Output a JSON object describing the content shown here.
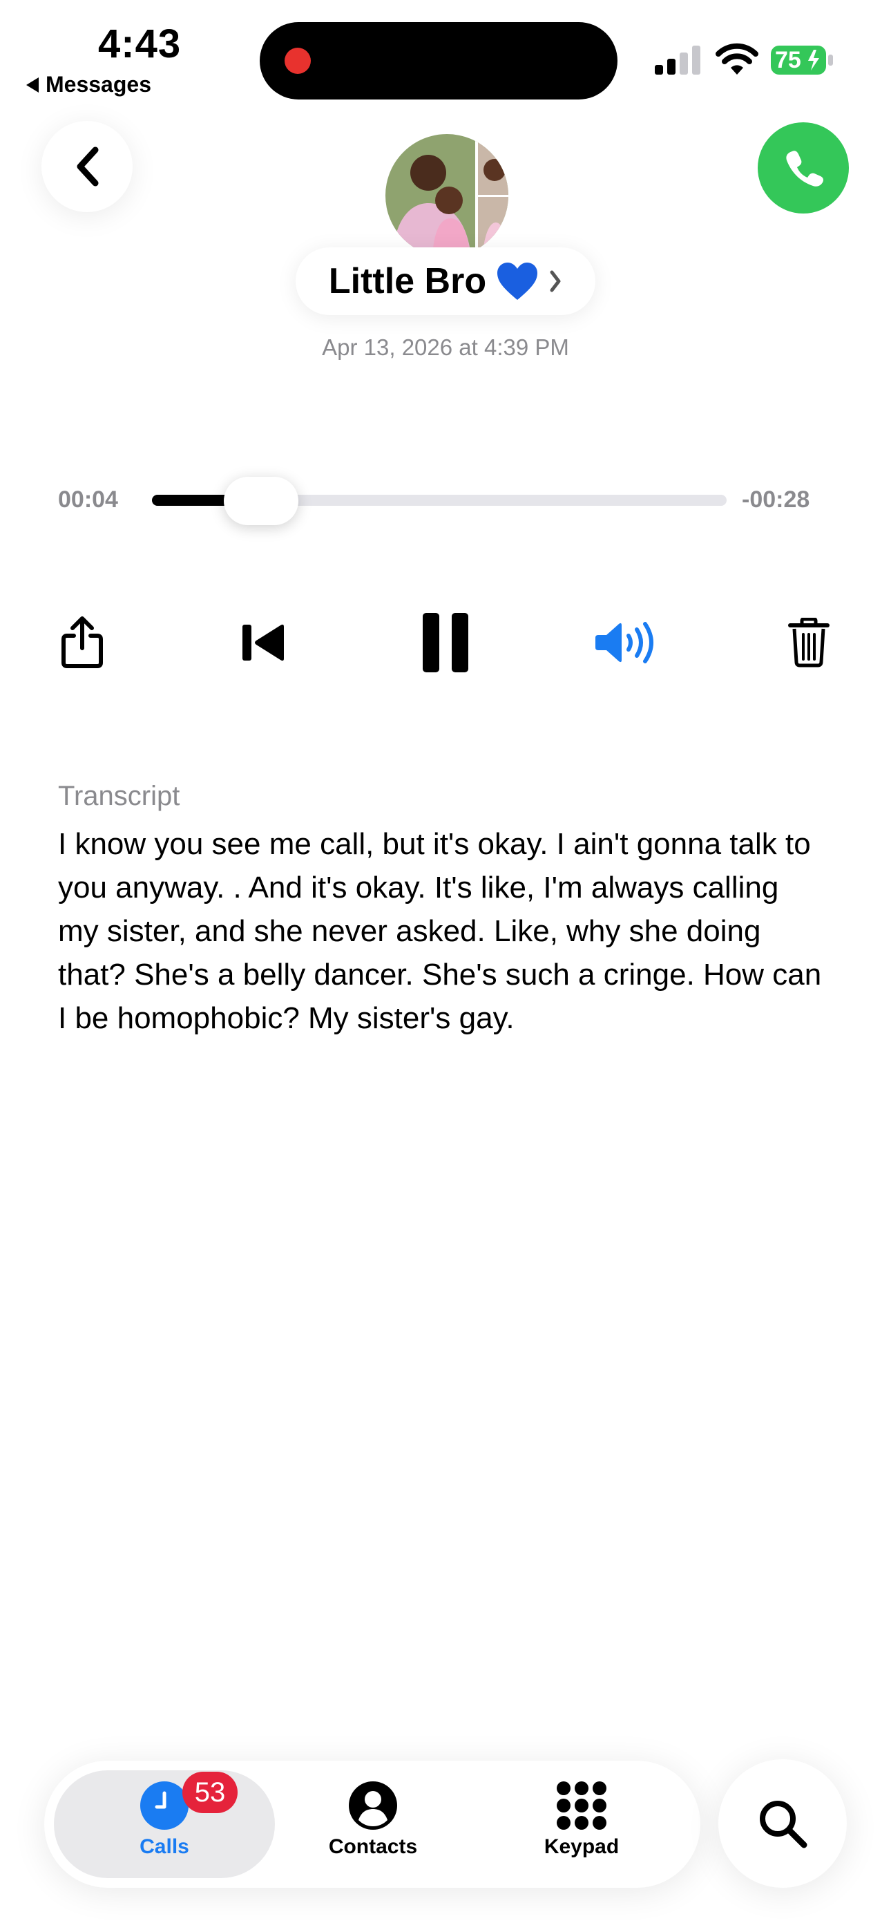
{
  "status_bar": {
    "time": "4:43",
    "back_app": "Messages",
    "battery": "75"
  },
  "contact": {
    "name": "Little Bro",
    "emoji": "💙",
    "date": "Apr 13, 2026 at 4:39 PM"
  },
  "player": {
    "elapsed": "00:04",
    "remaining": "-00:28",
    "progress": 0.125
  },
  "transcript": {
    "label": "Transcript",
    "text": "I know you see me call, but it's okay.  I ain't gonna talk to you anyway. .  And it's okay.  It's like, I'm always calling my sister, and she never asked.  Like, why she doing that? She's a belly dancer.  She's such a cringe.  How can I be homophobic?  My sister's gay."
  },
  "tabs": {
    "calls": "Calls",
    "calls_badge": "53",
    "contacts": "Contacts",
    "keypad": "Keypad"
  },
  "colors": {
    "accent": "#1a7cf2",
    "call_green": "#34c759",
    "badge_red": "#e5233b",
    "recording_red": "#e8322e"
  }
}
